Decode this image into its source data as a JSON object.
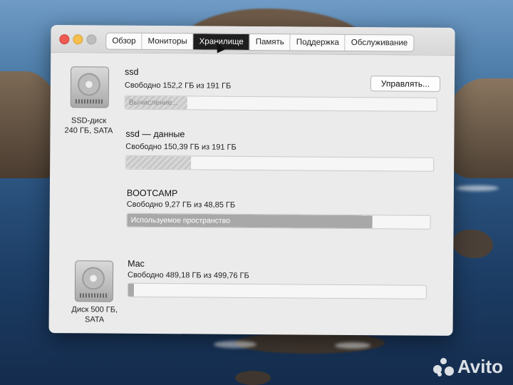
{
  "window": {
    "tabs": [
      "Обзор",
      "Мониторы",
      "Хранилище",
      "Память",
      "Поддержка",
      "Обслуживание"
    ],
    "active_tab": "Хранилище"
  },
  "manage_button": "Управлять...",
  "disks": [
    {
      "caption_line1": "SSD-диск",
      "caption_line2": "240 ГБ, SATA",
      "volumes": [
        {
          "name": "ssd",
          "free": "Свободно 152,2 ГБ из 191 ГБ",
          "bar_label": "Вычисление...",
          "used_fraction": 0.2
        },
        {
          "name": "ssd — данные",
          "free": "Свободно 150,39 ГБ из 191 ГБ",
          "bar_label": "",
          "used_fraction": 0.21
        },
        {
          "name": "BOOTCAMP",
          "free": "Свободно 9,27 ГБ из 48,85 ГБ",
          "bar_label": "Используемое пространство",
          "used_fraction": 0.81
        }
      ]
    },
    {
      "caption_line1": "Диск 500 ГБ,",
      "caption_line2": "SATA",
      "volumes": [
        {
          "name": "Mac",
          "free": "Свободно 489,18 ГБ из 499,76 ГБ",
          "bar_label": "",
          "used_fraction": 0.02
        }
      ]
    }
  ],
  "watermark": "Avito"
}
